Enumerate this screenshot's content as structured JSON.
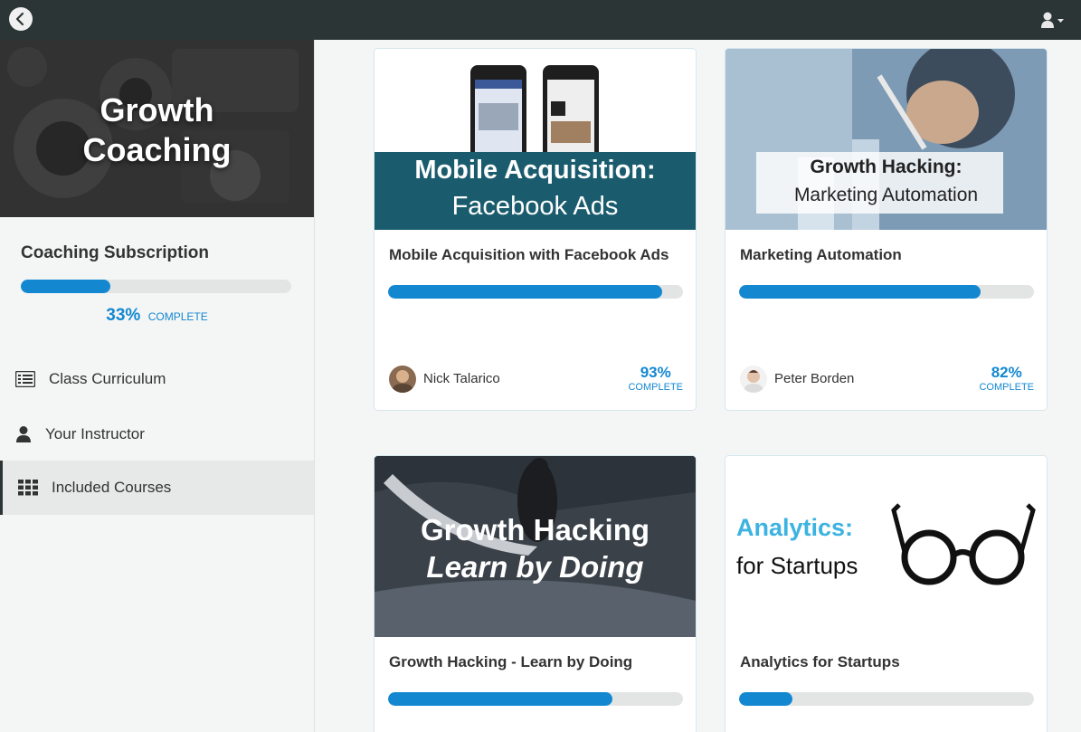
{
  "topbar": {
    "back_icon": "chevron-left-icon",
    "user_icon": "user-icon"
  },
  "sidebar": {
    "hero_title_line1": "Growth",
    "hero_title_line2": "Coaching",
    "subscription_title": "Coaching Subscription",
    "subscription_progress": 0.33,
    "subscription_percent": "33%",
    "subscription_complete_label": "COMPLETE",
    "nav": [
      {
        "label": "Class Curriculum",
        "icon": "list-icon"
      },
      {
        "label": "Your Instructor",
        "icon": "user-icon"
      },
      {
        "label": "Included Courses",
        "icon": "grid-icon",
        "active": true
      }
    ]
  },
  "courses": [
    {
      "title": "Mobile Acquisition with Facebook Ads",
      "image_line1": "Mobile Acquisition:",
      "image_line2": "Facebook Ads",
      "progress": 0.93,
      "instructor": "Nick Talarico",
      "percent": "93%",
      "complete_label": "COMPLETE"
    },
    {
      "title": "Marketing Automation",
      "image_line1": "Growth Hacking:",
      "image_line2": "Marketing Automation",
      "progress": 0.82,
      "instructor": "Peter Borden",
      "percent": "82%",
      "complete_label": "COMPLETE"
    },
    {
      "title": "Growth Hacking - Learn by Doing",
      "image_line1": "Growth Hacking",
      "image_line2": "Learn by Doing",
      "progress": 0.76
    },
    {
      "title": "Analytics for Startups",
      "image_line1": "Analytics:",
      "image_line2": "for Startups",
      "progress": 0.18
    }
  ],
  "colors": {
    "accent": "#1388d1",
    "topbar": "#2b3535",
    "fb_banner": "#1a5c6e",
    "analytics": "#3cb3e0"
  }
}
